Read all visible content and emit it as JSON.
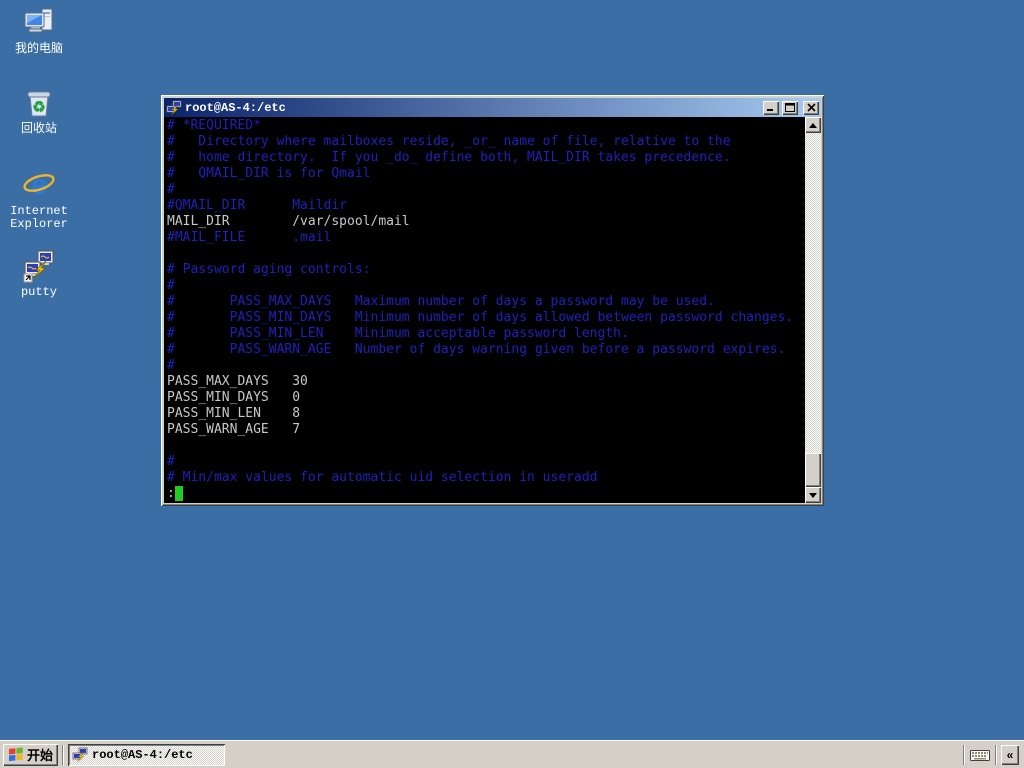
{
  "colors": {
    "desktop_bg": "#3B6EA5",
    "chrome": "#D4D0C8",
    "title_from": "#0A246A",
    "title_to": "#A6CAF0",
    "term_bg": "#000000",
    "term_comment": "#2020B8",
    "term_text": "#C8C8C8",
    "term_cursor": "#22CC22"
  },
  "desktop": {
    "icons": [
      {
        "label": "我的电脑"
      },
      {
        "label": "回收站"
      },
      {
        "label": "Internet Explorer"
      },
      {
        "label": "putty"
      }
    ]
  },
  "window": {
    "title": "root@AS-4:/etc",
    "controls": [
      "minimize",
      "maximize",
      "close"
    ]
  },
  "terminal": {
    "lines": [
      {
        "text": "# *REQUIRED*",
        "type": "comment"
      },
      {
        "text": "#   Directory where mailboxes reside, _or_ name of file, relative to the",
        "type": "comment"
      },
      {
        "text": "#   home directory.  If you _do_ define both, MAIL_DIR takes precedence.",
        "type": "comment"
      },
      {
        "text": "#   QMAIL_DIR is for Qmail",
        "type": "comment"
      },
      {
        "text": "#",
        "type": "comment"
      },
      {
        "text": "#QMAIL_DIR      Maildir",
        "type": "comment"
      },
      {
        "text": "MAIL_DIR        /var/spool/mail",
        "type": "normal"
      },
      {
        "text": "#MAIL_FILE      .mail",
        "type": "comment"
      },
      {
        "text": "",
        "type": "normal"
      },
      {
        "text": "# Password aging controls:",
        "type": "comment"
      },
      {
        "text": "#",
        "type": "comment"
      },
      {
        "text": "#       PASS_MAX_DAYS   Maximum number of days a password may be used.",
        "type": "comment"
      },
      {
        "text": "#       PASS_MIN_DAYS   Minimum number of days allowed between password changes.",
        "type": "comment"
      },
      {
        "text": "#       PASS_MIN_LEN    Minimum acceptable password length.",
        "type": "comment"
      },
      {
        "text": "#       PASS_WARN_AGE   Number of days warning given before a password expires.",
        "type": "comment"
      },
      {
        "text": "#",
        "type": "comment"
      },
      {
        "text": "PASS_MAX_DAYS   30",
        "type": "normal"
      },
      {
        "text": "PASS_MIN_DAYS   0",
        "type": "normal"
      },
      {
        "text": "PASS_MIN_LEN    8",
        "type": "normal"
      },
      {
        "text": "PASS_WARN_AGE   7",
        "type": "normal"
      },
      {
        "text": "",
        "type": "normal"
      },
      {
        "text": "#",
        "type": "comment"
      },
      {
        "text": "# Min/max values for automatic uid selection in useradd",
        "type": "comment"
      },
      {
        "text": ":",
        "type": "normal",
        "cursor": true
      }
    ]
  },
  "taskbar": {
    "start_label": "开始",
    "tasks": [
      {
        "label": "root@AS-4:/etc",
        "active": true
      }
    ],
    "tray": {
      "expand_label": "«"
    }
  }
}
